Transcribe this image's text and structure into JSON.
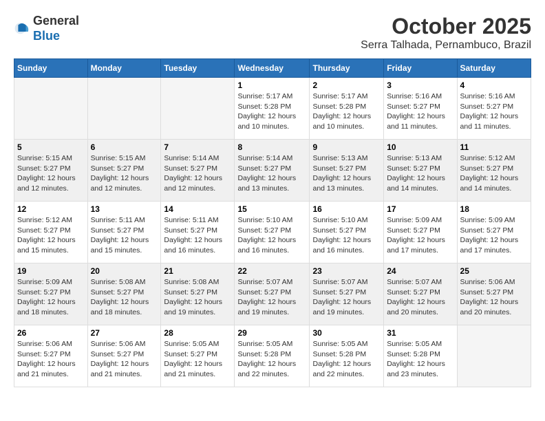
{
  "logo": {
    "general": "General",
    "blue": "Blue"
  },
  "title": "October 2025",
  "subtitle": "Serra Talhada, Pernambuco, Brazil",
  "days_of_week": [
    "Sunday",
    "Monday",
    "Tuesday",
    "Wednesday",
    "Thursday",
    "Friday",
    "Saturday"
  ],
  "weeks": [
    [
      {
        "num": "",
        "info": ""
      },
      {
        "num": "",
        "info": ""
      },
      {
        "num": "",
        "info": ""
      },
      {
        "num": "1",
        "info": "Sunrise: 5:17 AM\nSunset: 5:28 PM\nDaylight: 12 hours and 10 minutes."
      },
      {
        "num": "2",
        "info": "Sunrise: 5:17 AM\nSunset: 5:28 PM\nDaylight: 12 hours and 10 minutes."
      },
      {
        "num": "3",
        "info": "Sunrise: 5:16 AM\nSunset: 5:27 PM\nDaylight: 12 hours and 11 minutes."
      },
      {
        "num": "4",
        "info": "Sunrise: 5:16 AM\nSunset: 5:27 PM\nDaylight: 12 hours and 11 minutes."
      }
    ],
    [
      {
        "num": "5",
        "info": "Sunrise: 5:15 AM\nSunset: 5:27 PM\nDaylight: 12 hours and 12 minutes."
      },
      {
        "num": "6",
        "info": "Sunrise: 5:15 AM\nSunset: 5:27 PM\nDaylight: 12 hours and 12 minutes."
      },
      {
        "num": "7",
        "info": "Sunrise: 5:14 AM\nSunset: 5:27 PM\nDaylight: 12 hours and 12 minutes."
      },
      {
        "num": "8",
        "info": "Sunrise: 5:14 AM\nSunset: 5:27 PM\nDaylight: 12 hours and 13 minutes."
      },
      {
        "num": "9",
        "info": "Sunrise: 5:13 AM\nSunset: 5:27 PM\nDaylight: 12 hours and 13 minutes."
      },
      {
        "num": "10",
        "info": "Sunrise: 5:13 AM\nSunset: 5:27 PM\nDaylight: 12 hours and 14 minutes."
      },
      {
        "num": "11",
        "info": "Sunrise: 5:12 AM\nSunset: 5:27 PM\nDaylight: 12 hours and 14 minutes."
      }
    ],
    [
      {
        "num": "12",
        "info": "Sunrise: 5:12 AM\nSunset: 5:27 PM\nDaylight: 12 hours and 15 minutes."
      },
      {
        "num": "13",
        "info": "Sunrise: 5:11 AM\nSunset: 5:27 PM\nDaylight: 12 hours and 15 minutes."
      },
      {
        "num": "14",
        "info": "Sunrise: 5:11 AM\nSunset: 5:27 PM\nDaylight: 12 hours and 16 minutes."
      },
      {
        "num": "15",
        "info": "Sunrise: 5:10 AM\nSunset: 5:27 PM\nDaylight: 12 hours and 16 minutes."
      },
      {
        "num": "16",
        "info": "Sunrise: 5:10 AM\nSunset: 5:27 PM\nDaylight: 12 hours and 16 minutes."
      },
      {
        "num": "17",
        "info": "Sunrise: 5:09 AM\nSunset: 5:27 PM\nDaylight: 12 hours and 17 minutes."
      },
      {
        "num": "18",
        "info": "Sunrise: 5:09 AM\nSunset: 5:27 PM\nDaylight: 12 hours and 17 minutes."
      }
    ],
    [
      {
        "num": "19",
        "info": "Sunrise: 5:09 AM\nSunset: 5:27 PM\nDaylight: 12 hours and 18 minutes."
      },
      {
        "num": "20",
        "info": "Sunrise: 5:08 AM\nSunset: 5:27 PM\nDaylight: 12 hours and 18 minutes."
      },
      {
        "num": "21",
        "info": "Sunrise: 5:08 AM\nSunset: 5:27 PM\nDaylight: 12 hours and 19 minutes."
      },
      {
        "num": "22",
        "info": "Sunrise: 5:07 AM\nSunset: 5:27 PM\nDaylight: 12 hours and 19 minutes."
      },
      {
        "num": "23",
        "info": "Sunrise: 5:07 AM\nSunset: 5:27 PM\nDaylight: 12 hours and 19 minutes."
      },
      {
        "num": "24",
        "info": "Sunrise: 5:07 AM\nSunset: 5:27 PM\nDaylight: 12 hours and 20 minutes."
      },
      {
        "num": "25",
        "info": "Sunrise: 5:06 AM\nSunset: 5:27 PM\nDaylight: 12 hours and 20 minutes."
      }
    ],
    [
      {
        "num": "26",
        "info": "Sunrise: 5:06 AM\nSunset: 5:27 PM\nDaylight: 12 hours and 21 minutes."
      },
      {
        "num": "27",
        "info": "Sunrise: 5:06 AM\nSunset: 5:27 PM\nDaylight: 12 hours and 21 minutes."
      },
      {
        "num": "28",
        "info": "Sunrise: 5:05 AM\nSunset: 5:27 PM\nDaylight: 12 hours and 21 minutes."
      },
      {
        "num": "29",
        "info": "Sunrise: 5:05 AM\nSunset: 5:28 PM\nDaylight: 12 hours and 22 minutes."
      },
      {
        "num": "30",
        "info": "Sunrise: 5:05 AM\nSunset: 5:28 PM\nDaylight: 12 hours and 22 minutes."
      },
      {
        "num": "31",
        "info": "Sunrise: 5:05 AM\nSunset: 5:28 PM\nDaylight: 12 hours and 23 minutes."
      },
      {
        "num": "",
        "info": ""
      }
    ]
  ]
}
